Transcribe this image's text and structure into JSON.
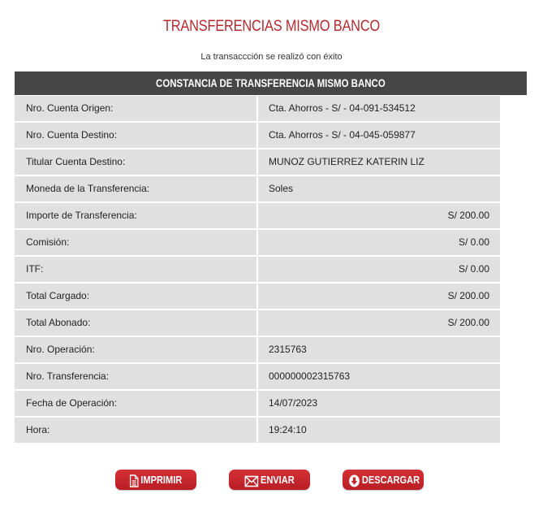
{
  "page": {
    "title": "TRANSFERENCIAS MISMO BANCO",
    "status_message": "La transaccción se realizó con éxito"
  },
  "receipt": {
    "header": "CONSTANCIA DE TRANSFERENCIA MISMO BANCO",
    "rows": [
      {
        "label": "Nro. Cuenta Origen:",
        "value": "Cta. Ahorros - S/ - 04-091-534512"
      },
      {
        "label": "Nro. Cuenta Destino:",
        "value": "Cta. Ahorros - S/ - 04-045-059877"
      },
      {
        "label": "Titular Cuenta Destino:",
        "value": "MUNOZ GUTIERREZ KATERIN LIZ"
      },
      {
        "label": "Moneda de la Transferencia:",
        "value": "Soles"
      },
      {
        "label": "Importe de Transferencia:",
        "value": "S/ 200.00"
      },
      {
        "label": "Comisión:",
        "value": "S/ 0.00"
      },
      {
        "label": "ITF:",
        "value": "S/ 0.00"
      },
      {
        "label": "Total Cargado:",
        "value": "S/ 200.00"
      },
      {
        "label": "Total Abonado:",
        "value": "S/ 200.00"
      },
      {
        "label": "Nro. Operación:",
        "value": "2315763"
      },
      {
        "label": "Nro. Transferencia:",
        "value": "000000002315763"
      },
      {
        "label": "Fecha de Operación:",
        "value": "14/07/2023"
      },
      {
        "label": "Hora:",
        "value": "19:24:10"
      }
    ]
  },
  "actions": {
    "print_label": "IMPRIMIR",
    "send_label": "ENVIAR",
    "download_label": "DESCARGAR"
  },
  "icons": {
    "print": "document-icon",
    "send": "envelope-icon",
    "download": "download-arrow-icon"
  },
  "colors": {
    "brand_red": "#b5292e",
    "header_bg": "#464646",
    "row_bg": "#e0e0e0",
    "button_red": "#c8242a"
  }
}
